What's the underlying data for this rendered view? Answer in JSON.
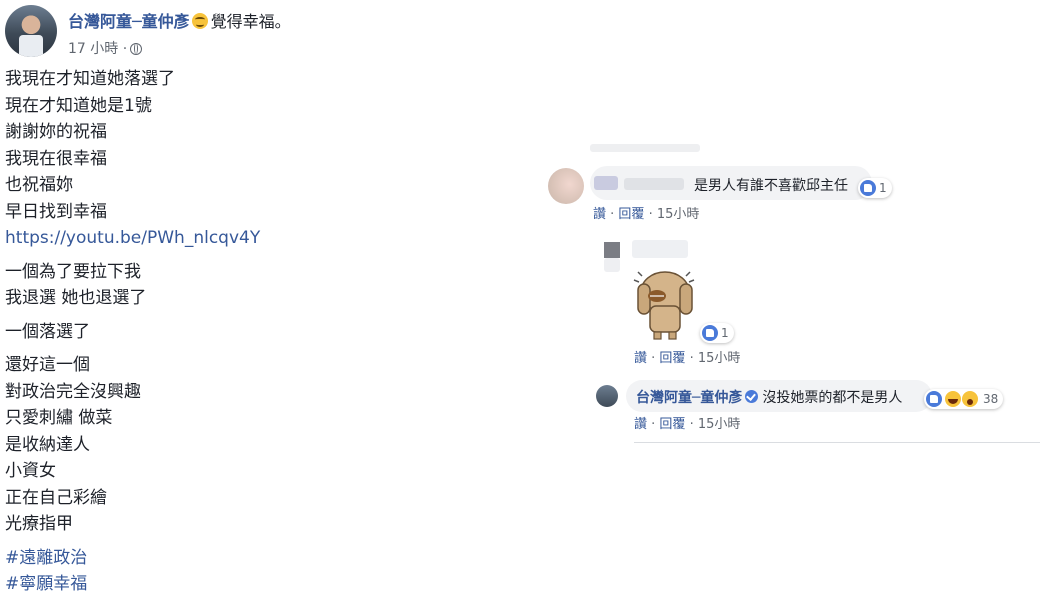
{
  "post": {
    "author": "台灣阿童─童仲彥",
    "feeling": "覺得幸福。",
    "time": "17 小時 ·",
    "lines": [
      "我現在才知道她落選了",
      "現在才知道她是1號",
      "謝謝妳的祝福",
      "我現在很幸福",
      "也祝福妳",
      "早日找到幸福"
    ],
    "link": "https://youtu.be/PWh_nlcqv4Y",
    "lines2": [
      "一個為了要拉下我",
      "我退選 她也退選了"
    ],
    "lines3": [
      "一個落選了"
    ],
    "lines4": [
      "還好這一個",
      "對政治完全沒興趣",
      "只愛刺繡 做菜",
      "是收納達人",
      "小資女",
      "正在自己彩繪",
      "光療指甲"
    ],
    "hashtags": [
      "#遠離政治",
      "#寧願幸福"
    ]
  },
  "comments": [
    {
      "text": "是男人有誰不喜歡邱主任",
      "reaction_count": "1",
      "like": "讚",
      "reply": "回覆",
      "time": "· 15小時"
    },
    {
      "reaction_count": "1",
      "like": "讚",
      "reply": "回覆",
      "time": "· 15小時"
    },
    {
      "author": "台灣阿童─童仲彥",
      "text": "沒投她票的都不是男人",
      "reaction_count": "38",
      "like": "讚",
      "reply": "回覆",
      "time": "· 15小時"
    }
  ],
  "colors": {
    "link": "#365899",
    "bubble": "#f2f3f5",
    "like_blue": "#4a7ad9"
  }
}
